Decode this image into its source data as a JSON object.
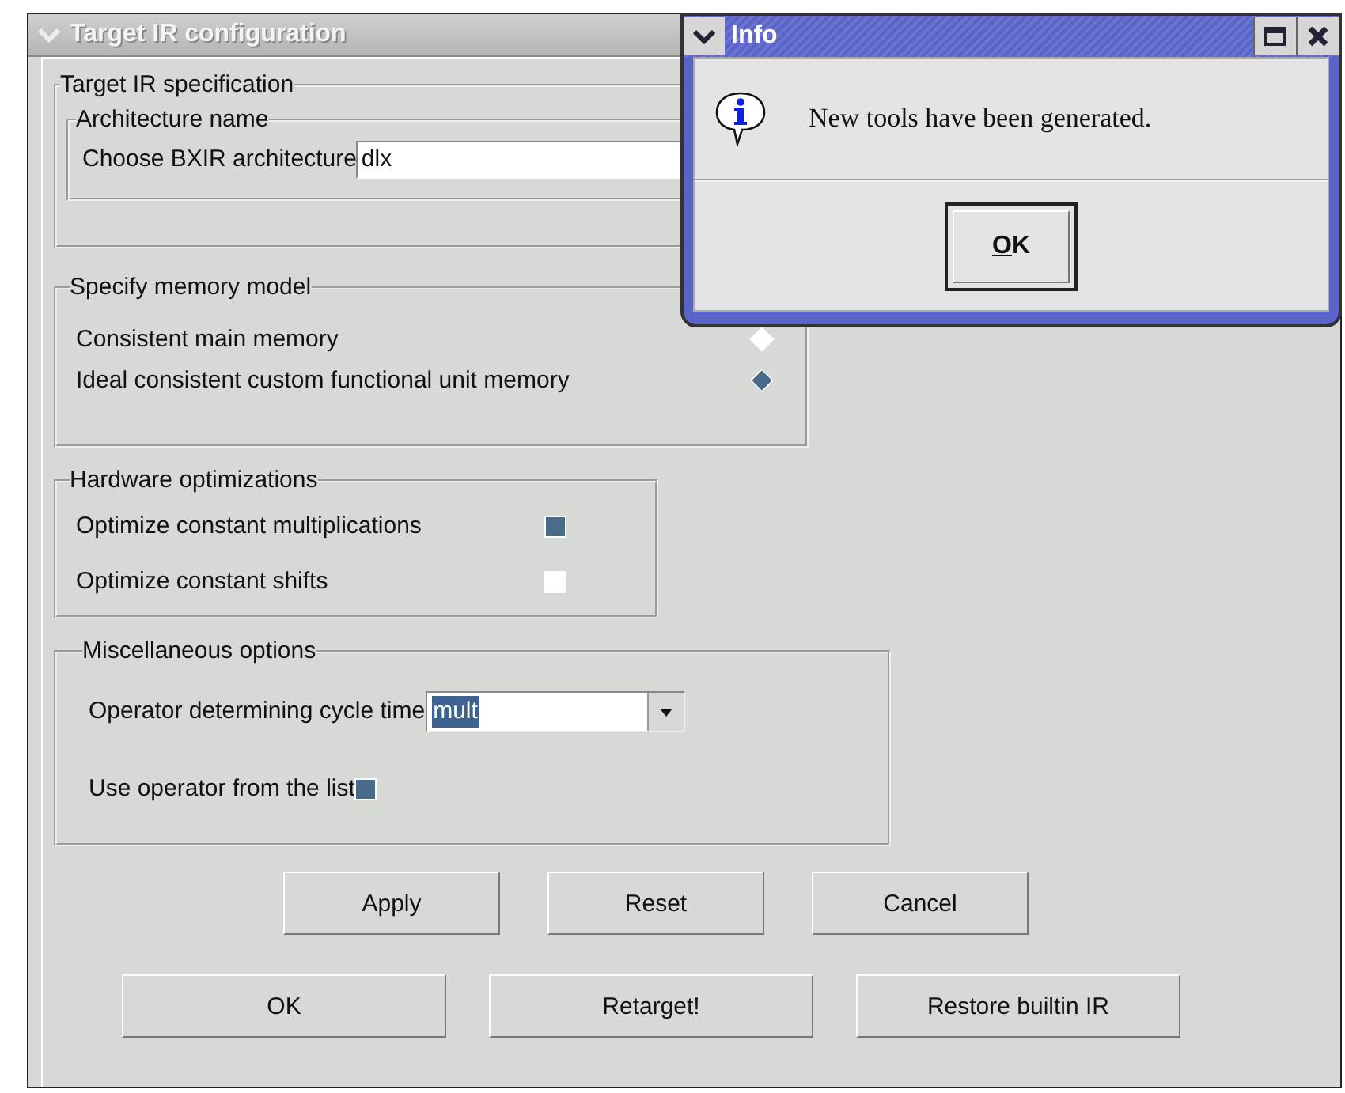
{
  "window": {
    "title": "Target IR configuration"
  },
  "target_ir_specification": {
    "title": "Target IR specification",
    "architecture_name": {
      "title": "Architecture name",
      "label": "Choose BXIR architecture",
      "value": "dlx"
    }
  },
  "memory_model": {
    "title": "Specify memory model",
    "options": [
      {
        "label": "Consistent main memory",
        "selected": false
      },
      {
        "label": "Ideal consistent custom functional unit memory",
        "selected": true
      }
    ]
  },
  "hardware_optimizations": {
    "title": "Hardware optimizations",
    "options": [
      {
        "label": "Optimize constant multiplications",
        "checked": true
      },
      {
        "label": "Optimize constant shifts",
        "checked": false
      }
    ]
  },
  "miscellaneous_options": {
    "title": "Miscellaneous options",
    "operator": {
      "label": "Operator determining cycle time",
      "value": "mult"
    },
    "use_list": {
      "label": "Use operator from the list",
      "checked": true
    }
  },
  "buttons_row_1": [
    "Apply",
    "Reset",
    "Cancel"
  ],
  "buttons_row_2": [
    "OK",
    "Retarget!",
    "Restore builtin IR"
  ],
  "info_dialog": {
    "title": "Info",
    "message": "New tools have been generated.",
    "button": "OK"
  }
}
